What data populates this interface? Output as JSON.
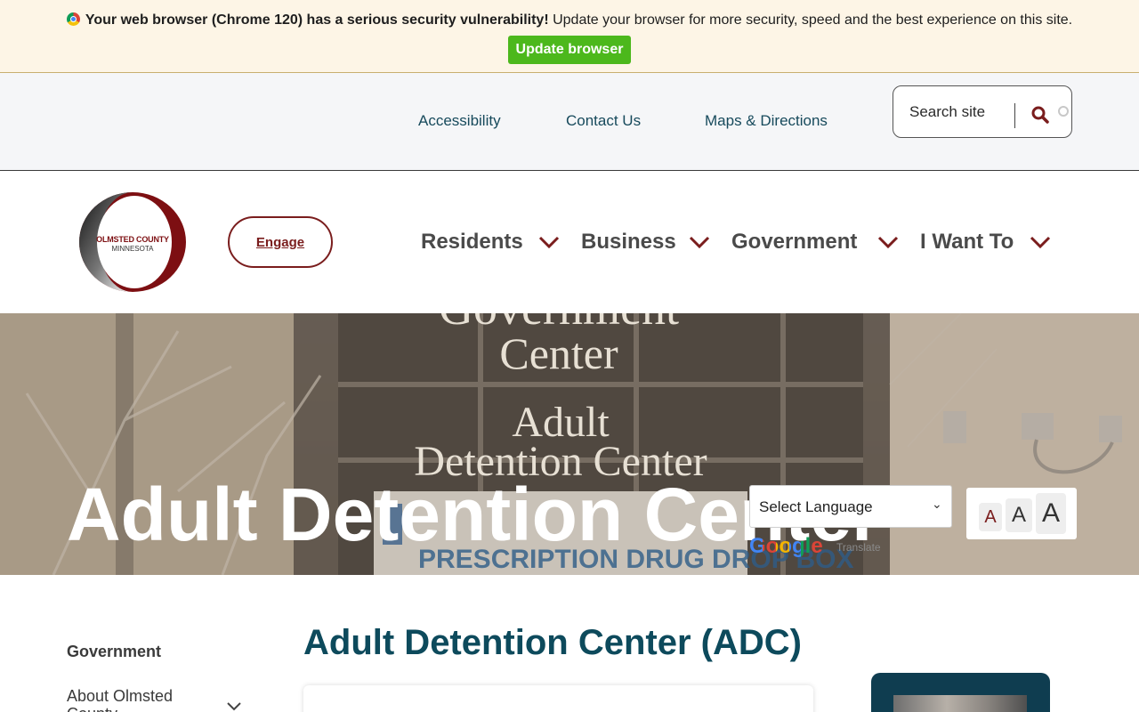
{
  "browser_warning": {
    "bold_text": "Your web browser (Chrome 120) has a serious security vulnerability!",
    "text": " Update your browser for more security, speed and the best experience on this site.",
    "button_label": "Update browser",
    "icon": "chrome-icon"
  },
  "utility_nav": {
    "links": [
      "Accessibility",
      "Contact Us",
      "Maps & Directions"
    ],
    "search": {
      "placeholder": "Search site",
      "icon": "search-icon"
    }
  },
  "header": {
    "logo": {
      "line1": "OLMSTED COUNTY",
      "line2": "MINNESOTA"
    },
    "engage_label": "Engage",
    "nav": [
      "Residents",
      "Business",
      "Government",
      "I Want To"
    ]
  },
  "hero": {
    "title": "Adult Detention Center",
    "sign_lines": [
      "Government",
      "Center",
      "Adult",
      "Detention Center"
    ],
    "dropbox_text": "PRESCRIPTION DRUG DROP BOX"
  },
  "translate": {
    "select_label": "Select Language",
    "google_word": "Google",
    "translate_word": "Translate"
  },
  "text_size": {
    "small": "A",
    "medium": "A",
    "large": "A"
  },
  "sidebar": {
    "heading": "Government",
    "items": [
      {
        "label": "About Olmsted County"
      }
    ]
  },
  "main": {
    "heading": "Adult Detention Center (ADC)"
  },
  "colors": {
    "brand_red": "#7a1d1d",
    "teal": "#0d4a5c",
    "update_green": "#4cb81c",
    "banner_bg": "#fdf5e6"
  }
}
